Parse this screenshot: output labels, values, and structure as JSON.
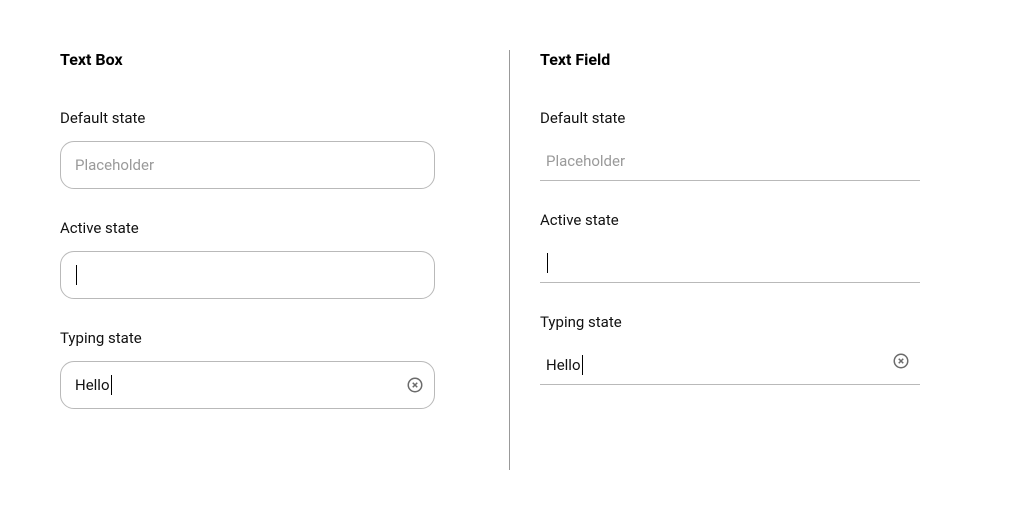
{
  "left": {
    "title": "Text Box",
    "states": {
      "default": {
        "label": "Default state",
        "placeholder": "Placeholder"
      },
      "active": {
        "label": "Active state",
        "value": ""
      },
      "typing": {
        "label": "Typing state",
        "value": "Hello"
      }
    }
  },
  "right": {
    "title": "Text Field",
    "states": {
      "default": {
        "label": "Default state",
        "placeholder": "Placeholder"
      },
      "active": {
        "label": "Active state",
        "value": ""
      },
      "typing": {
        "label": "Typing state",
        "value": "Hello"
      }
    }
  },
  "icons": {
    "clear": "clear-circle-icon"
  }
}
